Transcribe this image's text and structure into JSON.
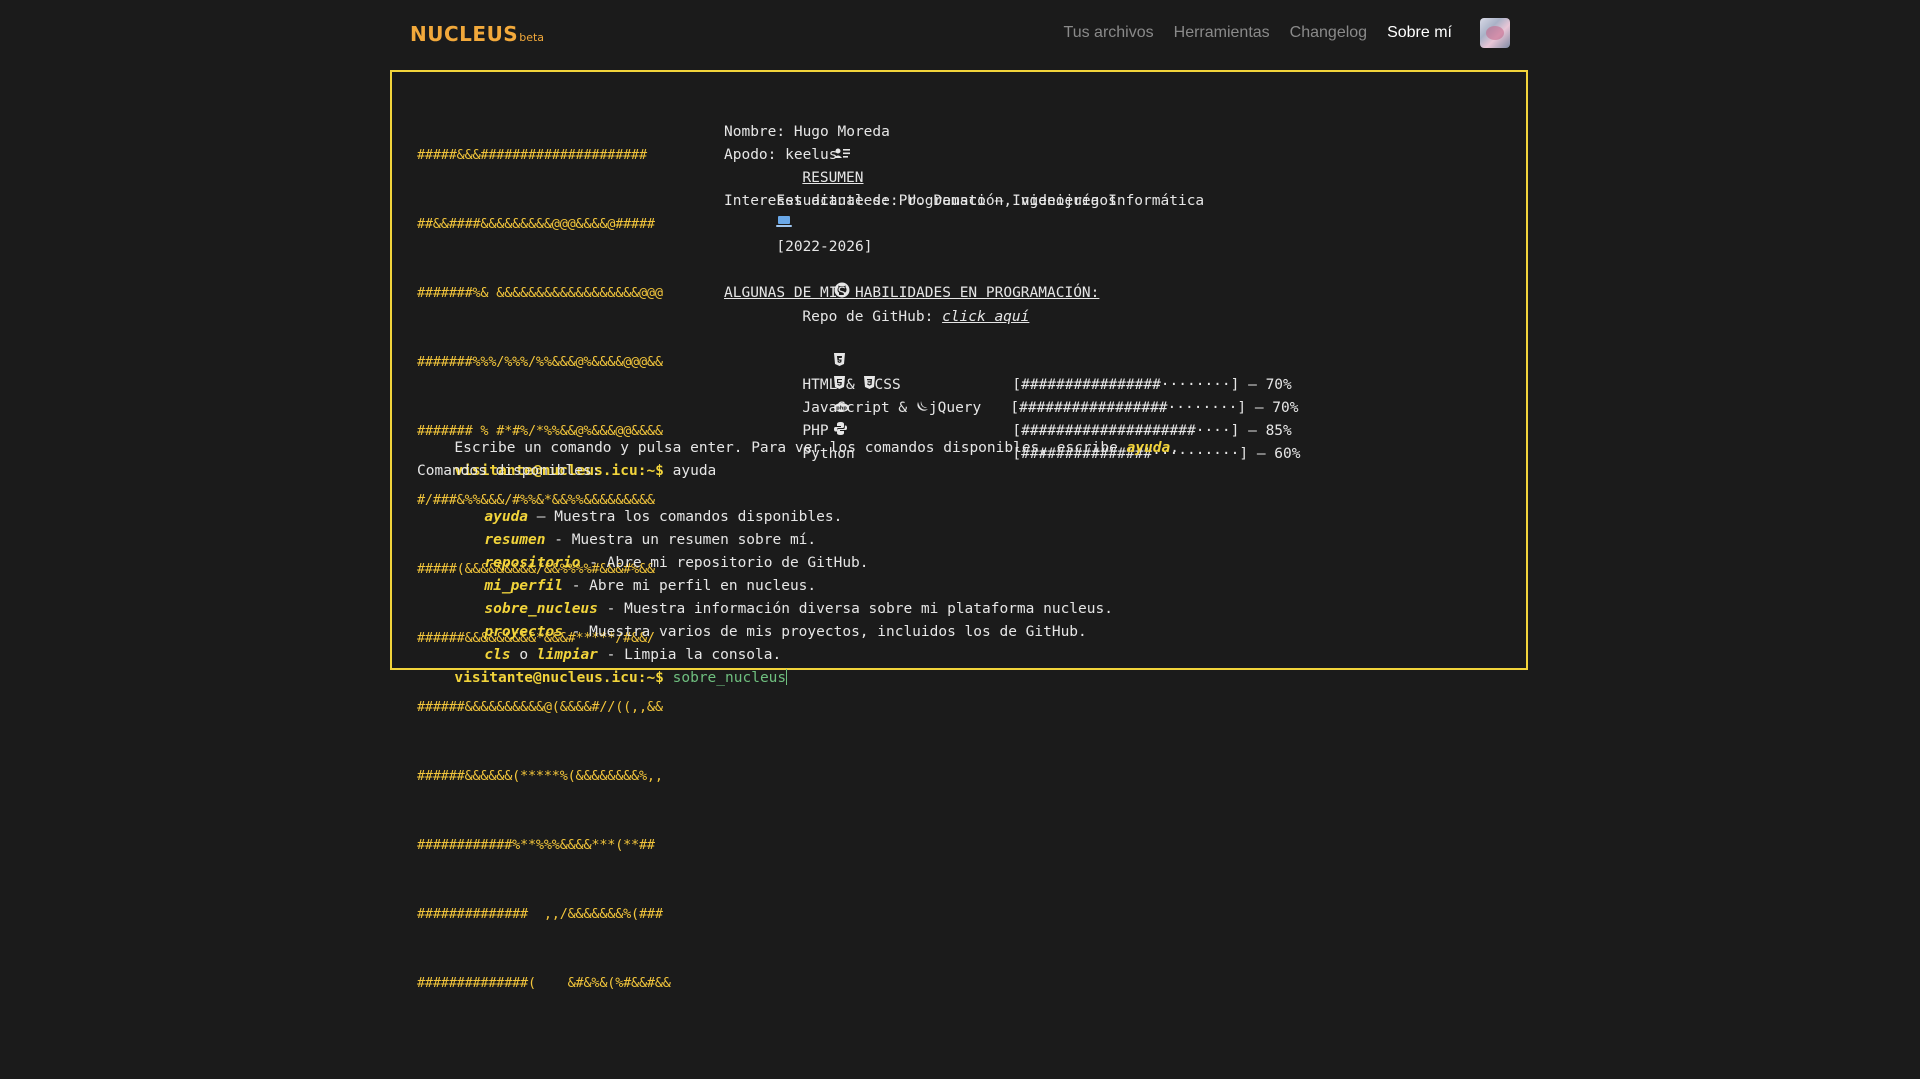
{
  "header": {
    "logo": "NUCLEUS",
    "logo_suffix": "beta",
    "nav": [
      {
        "label": "Tus archivos",
        "active": false
      },
      {
        "label": "Herramientas",
        "active": false
      },
      {
        "label": "Changelog",
        "active": false
      },
      {
        "label": "Sobre mí",
        "active": true
      }
    ]
  },
  "ascii_art": [
    "#####&&&#####################",
    "##&&####&&&&&&&&&@@@&&&&@#####",
    "#######%& &&&&&&&&&&&&&&&&&&@@@",
    "#######%%%/%%%/%%&&&@%&&&&@@@&&",
    "####### % #*#%/*%%&&@%&&&@@&&&&",
    "#/###&%%&&&/#%%&*&&%%&&&&&&&&&",
    "#####(&&&&&&&&&/&&%%%%#&&&#%&&",
    "######&&&&&&&&&*&&&#*****/#&&/",
    "######&&&&&&&&&&@(&&&&#//((,,&&",
    "######&&&&&&(*****%(&&&&&&&&%,,",
    "############%**%%%&&&&***(**##",
    "##############  ,,/&&&&&&&%(###",
    "##############(    &#&%&(%#&&#&&"
  ],
  "summary": {
    "title": "RESUMEN",
    "name": "Nombre: Hugo Moreda",
    "nickname": "Apodo: keelus",
    "student_prefix": "Estudiante de: U. Deusto – Ingeniería Informática",
    "student_years": "[2022-2026]",
    "interests": "Intereses actuales: Programación, videojuegos",
    "repo_label": "Repo de GitHub:",
    "repo_link": "click aquí",
    "skills_title": "ALGUNAS DE MIS HABILIDADES EN PROGRAMACIÓN:",
    "skills": [
      {
        "name_a": "HTML &",
        "name_b": "CSS",
        "bar": "[################········]",
        "percent": "– 70%"
      },
      {
        "name_a": "JavaScript &",
        "name_b": "jQuery",
        "bar": "[#################········]",
        "percent": "– 70%"
      },
      {
        "name_a": "PHP",
        "name_b": "",
        "bar": "[####################····]",
        "percent": "– 85%"
      },
      {
        "name_a": "Python",
        "name_b": "",
        "bar": "[###############··········]",
        "percent": "– 60%"
      }
    ]
  },
  "console": {
    "intro_pre": "Escribe un comando y pulsa enter. Para ver los comandos disponibles, escribe ",
    "intro_cmd": "ayuda",
    "intro_post": ".",
    "prompt": "visitante@nucleus.icu:~$",
    "first_input": "ayuda",
    "available_title": "Comandos disponibles:",
    "commands": [
      {
        "cmd": "ayuda",
        "sep": " — ",
        "desc": "Muestra los comandos disponibles."
      },
      {
        "cmd": "resumen",
        "sep": " - ",
        "desc": "Muestra un resumen sobre mí."
      },
      {
        "cmd": "repositorio",
        "sep": " - ",
        "desc": "Abre mi repositorio de GitHub."
      },
      {
        "cmd": "mi_perfil",
        "sep": " - ",
        "desc": "Abre mi perfil en nucleus."
      },
      {
        "cmd": "sobre_nucleus",
        "sep": " - ",
        "desc": "Muestra información diversa sobre mi plataforma nucleus."
      },
      {
        "cmd": "proyectos",
        "sep": " - ",
        "desc": "Muestra varios de mis proyectos, incluidos los de GitHub."
      }
    ],
    "cls_cmd": "cls",
    "cls_or": " o ",
    "cls_cmd2": "limpiar",
    "cls_desc": " - Limpia la consola.",
    "current_input": "sobre_nucleus"
  },
  "colors": {
    "accent": "#f2d43b",
    "logo": "#f2a93b",
    "background": "#1b1b1b",
    "typed": "#6fbf7f"
  }
}
